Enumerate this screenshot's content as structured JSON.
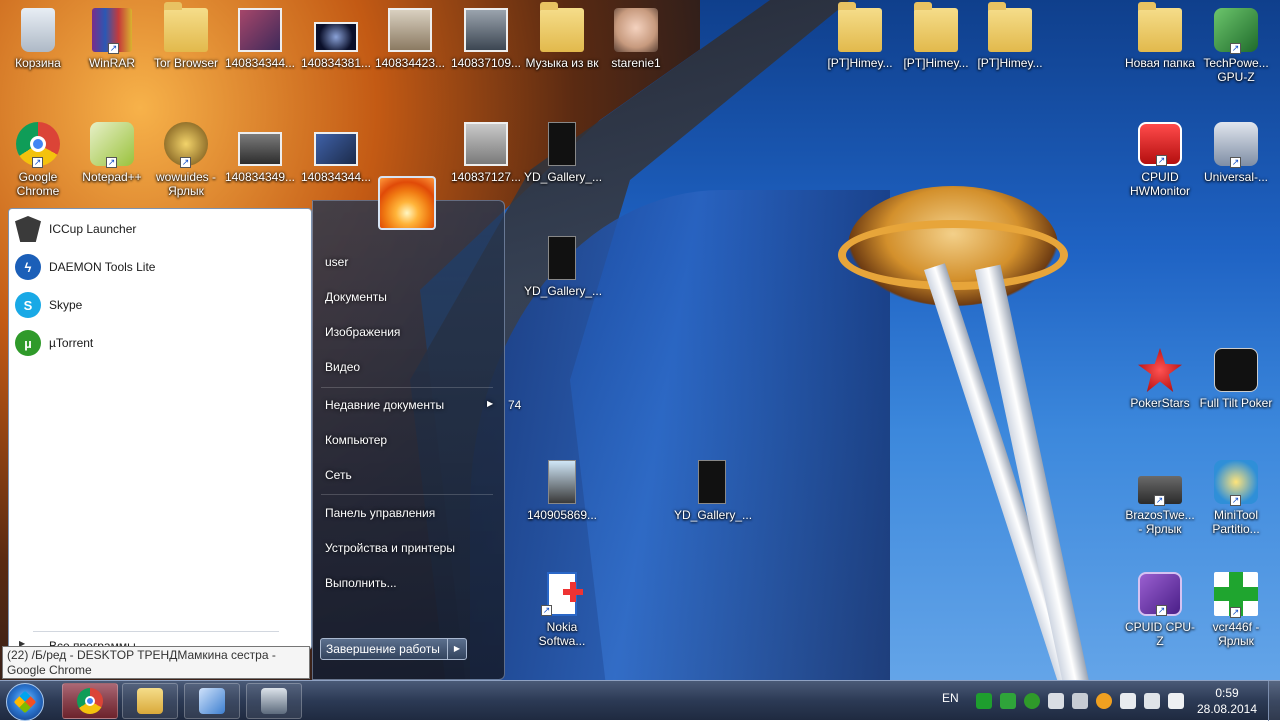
{
  "desktop": {
    "icons": [
      {
        "label": "Корзина",
        "icon": "recycle-bin-icon"
      },
      {
        "label": "WinRAR",
        "icon": "winrar-icon"
      },
      {
        "label": "Tor Browser",
        "icon": "folder-icon"
      },
      {
        "label": "140834344...",
        "icon": "image-icon"
      },
      {
        "label": "140834381...",
        "icon": "image-icon"
      },
      {
        "label": "140834423...",
        "icon": "image-icon"
      },
      {
        "label": "140837109...",
        "icon": "image-icon"
      },
      {
        "label": "Музыка из вк",
        "icon": "folder-icon"
      },
      {
        "label": "starenie1",
        "icon": "image-icon"
      },
      {
        "label": "[PT]Himey...",
        "icon": "folder-icon"
      },
      {
        "label": "[PT]Himey...",
        "icon": "folder-icon"
      },
      {
        "label": "[PT]Himey...",
        "icon": "folder-icon"
      },
      {
        "label": "Новая папка",
        "icon": "folder-icon"
      },
      {
        "label": "TechPowe... GPU-Z",
        "icon": "gpuz-icon"
      },
      {
        "label": "Google Chrome",
        "icon": "chrome-icon"
      },
      {
        "label": "Notepad++",
        "icon": "notepad-icon"
      },
      {
        "label": "wowuides - Ярлык",
        "icon": "wow-icon"
      },
      {
        "label": "140834349...",
        "icon": "image-icon"
      },
      {
        "label": "140834344...",
        "icon": "image-icon"
      },
      {
        "label": "140837127...",
        "icon": "image-icon"
      },
      {
        "label": "YD_Gallery_...",
        "icon": "document-icon"
      },
      {
        "label": "CPUID HWMonitor",
        "icon": "hwmonitor-icon"
      },
      {
        "label": "Universal-...",
        "icon": "computer-icon"
      },
      {
        "label": "YD_Gallery_...",
        "icon": "document-icon"
      },
      {
        "label": "PokerStars",
        "icon": "pokerstars-icon"
      },
      {
        "label": "Full Tilt Poker",
        "icon": "fulltilt-icon"
      },
      {
        "label": "140905869...",
        "icon": "image-icon"
      },
      {
        "label": "YD_Gallery_...",
        "icon": "document-icon"
      },
      {
        "label": "BrazosTwe... - Ярлык",
        "icon": "chip-icon"
      },
      {
        "label": "MiniTool Partitio...",
        "icon": "minitool-icon"
      },
      {
        "label": "Nokia Softwa...",
        "icon": "nokia-icon"
      },
      {
        "label": "CPUID CPU-Z",
        "icon": "cpuz-icon"
      },
      {
        "label": "vcr446f - Ярлык",
        "icon": "plus-icon"
      }
    ],
    "hidden_fragment": "74"
  },
  "start_menu": {
    "programs": [
      {
        "label": "ICCup Launcher",
        "icon": "iccup-icon",
        "color": "#3a3a3a"
      },
      {
        "label": "DAEMON Tools Lite",
        "icon": "daemon-tools-icon",
        "color": "#1b5fb8"
      },
      {
        "label": "Skype",
        "icon": "skype-icon",
        "color": "#19a9e6"
      },
      {
        "label": "µTorrent",
        "icon": "utorrent-icon",
        "color": "#2f9a2a"
      }
    ],
    "all_programs_label": "Все программы",
    "right_links": [
      {
        "label": "user"
      },
      {
        "label": "Документы"
      },
      {
        "label": "Изображения"
      },
      {
        "label": "Видео"
      },
      {
        "label": "Недавние документы",
        "submenu": true
      },
      {
        "label": "Компьютер"
      },
      {
        "label": "Сеть"
      },
      {
        "label": "Панель управления"
      },
      {
        "label": "Устройства и принтеры"
      },
      {
        "label": "Выполнить..."
      }
    ],
    "shutdown_label": "Завершение работы"
  },
  "tooltip": {
    "text": "(22) /Б/ред - DESKTOP ТРЕНДМамкина сестра - Google Chrome"
  },
  "taskbar": {
    "buttons": [
      {
        "name": "chrome",
        "icon": "chrome-icon",
        "active": true
      },
      {
        "name": "explorer",
        "icon": "folder-icon"
      },
      {
        "name": "control-panel",
        "icon": "control-panel-icon"
      },
      {
        "name": "monitor",
        "icon": "monitor-icon"
      }
    ],
    "language": "EN",
    "tray_icons": [
      "battery-icon",
      "network-icon",
      "utorrent-icon",
      "flag-icon",
      "network-monitor-icon",
      "update-icon",
      "action-center-icon",
      "monitor-icon",
      "volume-icon"
    ],
    "clock_time": "0:59",
    "clock_date": "28.08.2014"
  },
  "colors": {
    "taskbar": "#2c3a55",
    "start_menu_left": "#ffffff",
    "start_menu_right": "#26334c",
    "active_taskbar_button": "#c8484a"
  }
}
